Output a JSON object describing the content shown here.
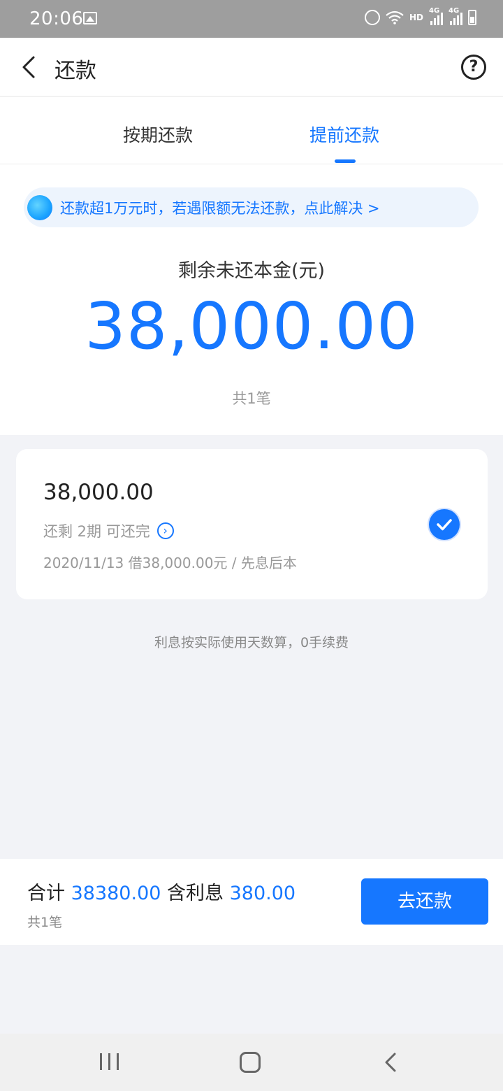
{
  "status_bar": {
    "time": "20:06",
    "network_left": "4G",
    "network_right": "4G",
    "hd": "HD"
  },
  "header": {
    "title": "还款",
    "back_icon": "chevron-left-icon",
    "help_icon": "question-circle-icon",
    "help_glyph": "?"
  },
  "tabs": [
    {
      "label": "按期还款",
      "active": false
    },
    {
      "label": "提前还款",
      "active": true
    }
  ],
  "notice": {
    "text": "还款超1万元时，若遇限额无法还款，点此解决 >"
  },
  "summary": {
    "label": "剩余未还本金(元)",
    "amount": "38,000.00",
    "count": "共1笔"
  },
  "loan_card": {
    "amount": "38,000.00",
    "remaining": "还剩 2期 可还完",
    "info": "2020/11/13 借38,000.00元 / 先息后本",
    "selected": true
  },
  "footnote": "利息按实际使用天数算，0手续费",
  "bottom": {
    "total_label": "合计",
    "total_value": "38380.00",
    "interest_label": "含利息",
    "interest_value": "380.00",
    "count": "共1笔",
    "button_label": "去还款"
  },
  "colors": {
    "accent": "#1677ff",
    "notice_bg": "#edf4fd",
    "page_bg": "#f2f3f7"
  }
}
